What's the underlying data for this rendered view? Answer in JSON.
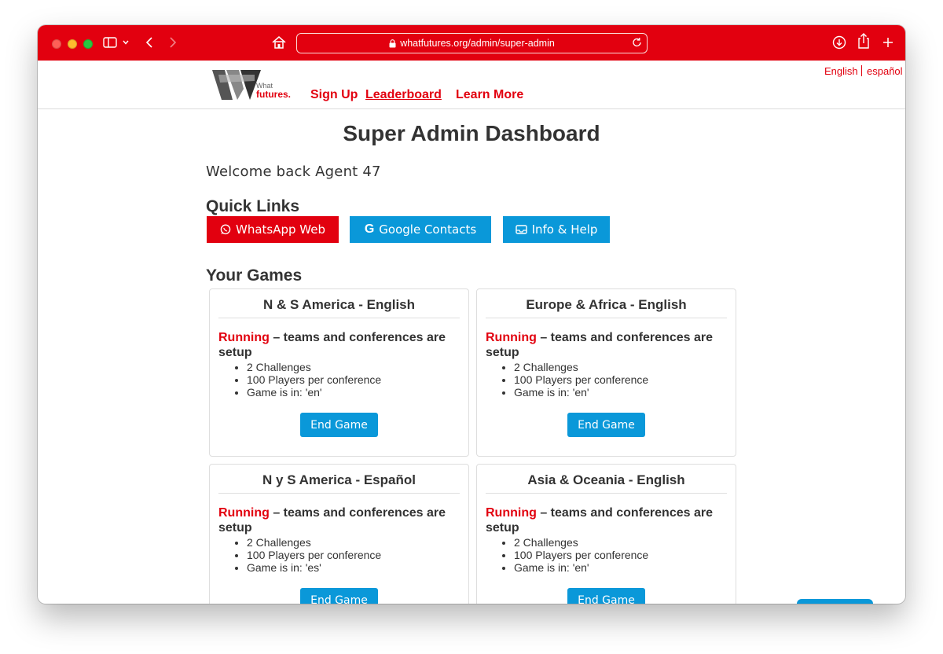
{
  "browser": {
    "url": "whatfutures.org/admin/super-admin",
    "toolbar_color": "#e2000f"
  },
  "header": {
    "logo_text_top": "What",
    "logo_text_bottom": "futures.",
    "nav": {
      "signup": "Sign Up",
      "leaderboard": "Leaderboard",
      "learn_more": "Learn More"
    },
    "lang": {
      "english": "English",
      "spanish": "español"
    }
  },
  "page": {
    "title": "Super Admin Dashboard",
    "welcome": "Welcome back Agent 47",
    "quick_links_heading": "Quick Links",
    "quick_links": {
      "whatsapp": "WhatsApp Web",
      "google": "Google Contacts",
      "info": "Info & Help"
    },
    "games_heading": "Your Games"
  },
  "games": [
    {
      "title": "N & S America - English",
      "status": "Running",
      "status_rest": " – teams and conferences are setup",
      "challenges": "2 Challenges",
      "players": "100 Players per conference",
      "lang": "Game is in: 'en'",
      "button": "End Game"
    },
    {
      "title": "Europe & Africa - English",
      "status": "Running",
      "status_rest": " – teams and conferences are setup",
      "challenges": "2 Challenges",
      "players": "100 Players per conference",
      "lang": "Game is in: 'en'",
      "button": "End Game"
    },
    {
      "title": "N y S America - Español",
      "status": "Running",
      "status_rest": " – teams and conferences are setup",
      "challenges": "2 Challenges",
      "players": "100 Players per conference",
      "lang": "Game is in: 'es'",
      "button": "End Game"
    },
    {
      "title": "Asia & Oceania - English",
      "status": "Running",
      "status_rest": " – teams and conferences are setup",
      "challenges": "2 Challenges",
      "players": "100 Players per conference",
      "lang": "Game is in: 'en'",
      "button": "End Game"
    }
  ],
  "colors": {
    "brand_red": "#e2000f",
    "button_blue": "#0a98d9"
  },
  "icons": [
    "sidebar-icon",
    "chevron-down-icon",
    "back-icon",
    "forward-icon",
    "home-icon",
    "lock-icon",
    "reload-icon",
    "download-icon",
    "share-icon",
    "new-tab-icon",
    "whatsapp-icon",
    "google-icon",
    "inbox-icon"
  ]
}
